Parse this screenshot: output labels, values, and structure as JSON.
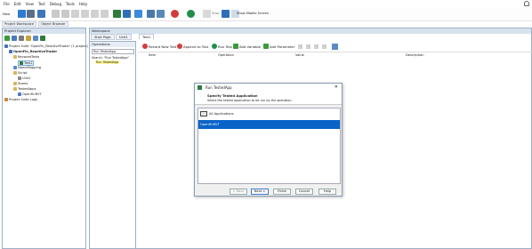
{
  "menu": [
    "File",
    "Edit",
    "View",
    "Test",
    "Debug",
    "Tools",
    "Help"
  ],
  "toolbar": {
    "new_label": "New",
    "stop_label": "Stop",
    "mobile_label": "Show Mobile Screen"
  },
  "top_tabs": [
    "Project Workspace",
    "Object Browser"
  ],
  "project_explorer": {
    "title": "Project Explorer",
    "items": [
      {
        "label": "Project Suite 'OpenFin_ReactiveTrader' (1 project)"
      },
      {
        "label": "OpenFin_ReactiveTrader"
      },
      {
        "label": "KeywordTests"
      },
      {
        "label": "Test1"
      },
      {
        "label": "NameMapping"
      },
      {
        "label": "Script"
      },
      {
        "label": "Unit1"
      },
      {
        "label": "Stores"
      },
      {
        "label": "TestedApps"
      },
      {
        "label": "OpenFinRVT"
      },
      {
        "label": "Project Suite Logs"
      }
    ]
  },
  "workspace": {
    "title": "Workspace",
    "tabs": [
      "Start Page",
      "Unit1",
      "Test1"
    ],
    "actions": [
      "Record New Test",
      "Append to Test",
      "Run Test",
      "Add Variable",
      "Add Parameter"
    ],
    "columns": [
      "Item",
      "Operation",
      "Value",
      "Description"
    ]
  },
  "operations": {
    "title": "Operations",
    "dropdown": "Run TestedApp",
    "search_label": "Search: \"Run TestedApp\"",
    "result": "Run TestedApp"
  },
  "dialog": {
    "title": "Run TestedApp",
    "heading": "Specify Tested Application",
    "subheading": "Select the tested application to be run by the operation.",
    "options": [
      "All Applications",
      "OpenFinRVT"
    ],
    "buttons": [
      "< Back",
      "Next >",
      "Finish",
      "Cancel",
      "Help"
    ]
  },
  "colors": {
    "accent": "#1c6fd1",
    "selection": "#0a64c8",
    "highlight": "#fff89a"
  }
}
